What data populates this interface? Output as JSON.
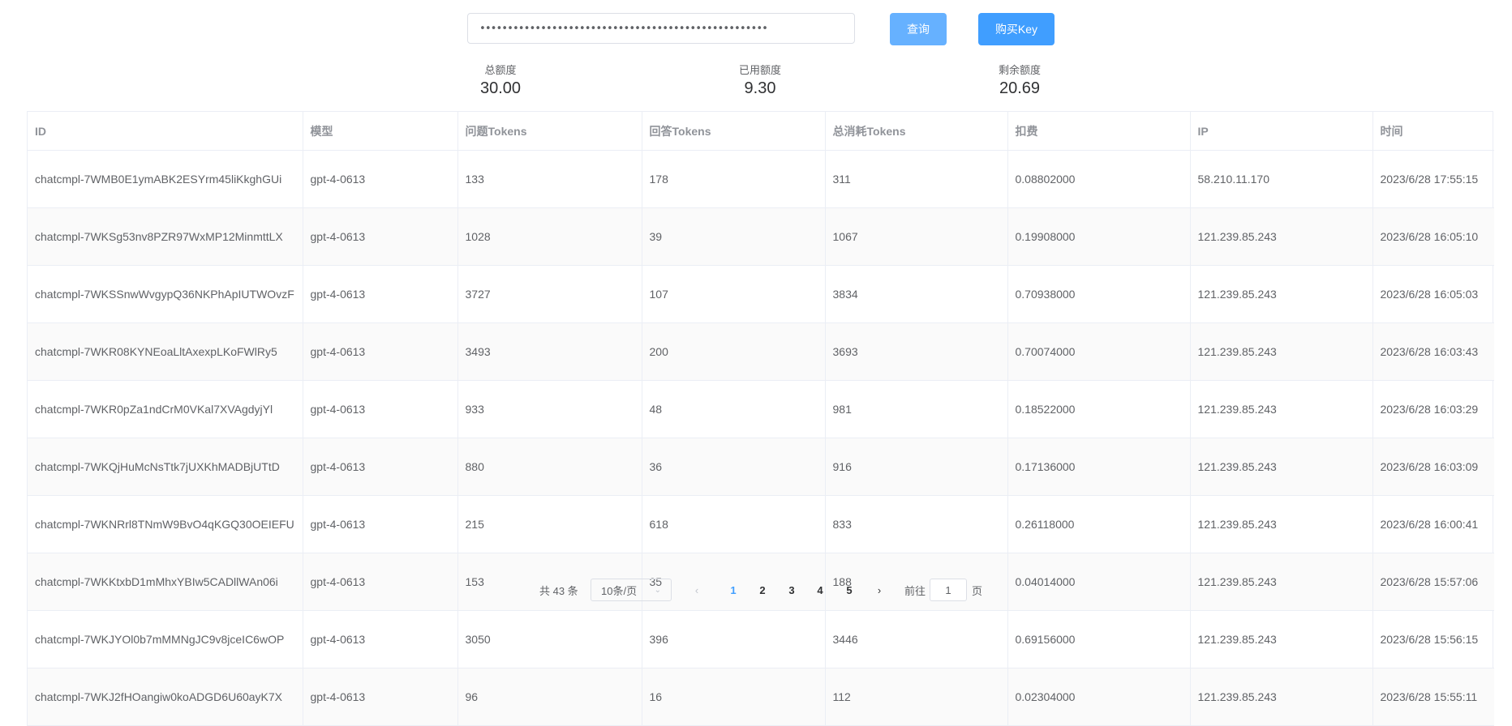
{
  "search": {
    "value": "••••••••••••••••••••••••••••••••••••••••••••••••••••",
    "query_label": "查询",
    "buy_label": "购买Key"
  },
  "stats": {
    "total_label": "总额度",
    "total_value": "30.00",
    "used_label": "已用额度",
    "used_value": "9.30",
    "remaining_label": "剩余额度",
    "remaining_value": "20.69"
  },
  "table": {
    "headers": [
      "ID",
      "模型",
      "问题Tokens",
      "回答Tokens",
      "总消耗Tokens",
      "扣费",
      "IP",
      "时间"
    ],
    "rows": [
      [
        "chatcmpl-7WMB0E1ymABK2ESYrm45liKkghGUi",
        "gpt-4-0613",
        "133",
        "178",
        "311",
        "0.08802000",
        "58.210.11.170",
        "2023/6/28 17:55:15"
      ],
      [
        "chatcmpl-7WKSg53nv8PZR97WxMP12MinmttLX",
        "gpt-4-0613",
        "1028",
        "39",
        "1067",
        "0.19908000",
        "121.239.85.243",
        "2023/6/28 16:05:10"
      ],
      [
        "chatcmpl-7WKSSnwWvgypQ36NKPhApIUTWOvzF",
        "gpt-4-0613",
        "3727",
        "107",
        "3834",
        "0.70938000",
        "121.239.85.243",
        "2023/6/28 16:05:03"
      ],
      [
        "chatcmpl-7WKR08KYNEoaLltAxexpLKoFWlRy5",
        "gpt-4-0613",
        "3493",
        "200",
        "3693",
        "0.70074000",
        "121.239.85.243",
        "2023/6/28 16:03:43"
      ],
      [
        "chatcmpl-7WKR0pZa1ndCrM0VKal7XVAgdyjYl",
        "gpt-4-0613",
        "933",
        "48",
        "981",
        "0.18522000",
        "121.239.85.243",
        "2023/6/28 16:03:29"
      ],
      [
        "chatcmpl-7WKQjHuMcNsTtk7jUXKhMADBjUTtD",
        "gpt-4-0613",
        "880",
        "36",
        "916",
        "0.17136000",
        "121.239.85.243",
        "2023/6/28 16:03:09"
      ],
      [
        "chatcmpl-7WKNRrl8TNmW9BvO4qKGQ30OEIEFU",
        "gpt-4-0613",
        "215",
        "618",
        "833",
        "0.26118000",
        "121.239.85.243",
        "2023/6/28 16:00:41"
      ],
      [
        "chatcmpl-7WKKtxbD1mMhxYBIw5CADllWAn06i",
        "gpt-4-0613",
        "153",
        "35",
        "188",
        "0.04014000",
        "121.239.85.243",
        "2023/6/28 15:57:06"
      ],
      [
        "chatcmpl-7WKJYOl0b7mMMNgJC9v8jceIC6wOP",
        "gpt-4-0613",
        "3050",
        "396",
        "3446",
        "0.69156000",
        "121.239.85.243",
        "2023/6/28 15:56:15"
      ],
      [
        "chatcmpl-7WKJ2fHOangiw0koADGD6U60ayK7X",
        "gpt-4-0613",
        "96",
        "16",
        "112",
        "0.02304000",
        "121.239.85.243",
        "2023/6/28 15:55:11"
      ]
    ]
  },
  "pagination": {
    "total_text": "共 43 条",
    "page_size": "10条/页",
    "pages": [
      "1",
      "2",
      "3",
      "4",
      "5"
    ],
    "current_page": "1",
    "goto_label": "前往",
    "goto_value": "1",
    "unit_label": "页"
  },
  "colors": {
    "primary": "#409eff",
    "primary_light": "#66b1ff",
    "border": "#ebeef5",
    "header_text": "#909399"
  }
}
